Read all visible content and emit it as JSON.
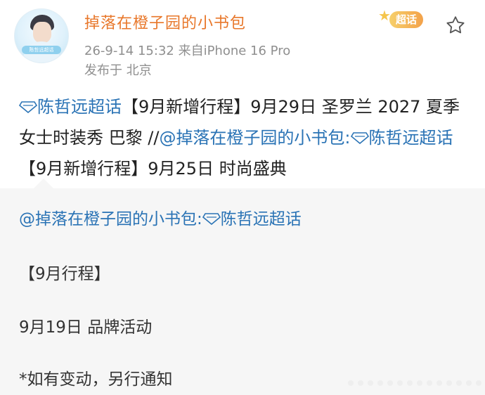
{
  "header": {
    "avatar_badge": "陈哲远超话",
    "username": "掉落在橙子园的小书包",
    "meta": "26-9-14 15:32  来自iPhone 16 Pro",
    "location": "发布于 北京",
    "supertopic_label": "超话"
  },
  "post": {
    "topic": "陈哲远超话",
    "text_part1": "【9月新增行程】9月29日 圣罗兰 2027 夏季女士时装秀 巴黎 //",
    "mention": "@掉落在橙子园的小书包:",
    "topic2": "陈哲远超话",
    "text_part2": "【9月新增行程】9月25日 时尚盛典"
  },
  "repost": {
    "author": "@掉落在橙子园的小书包:",
    "topic": "陈哲远超话",
    "line1": "【9月行程】",
    "line2": "9月19日 品牌活动",
    "line3": "*如有变动，另行通知"
  },
  "colors": {
    "username": "#e8772a",
    "link": "#2a73b5",
    "meta": "#8f8f8f",
    "repost_bg": "#f6f6f6"
  },
  "icons": [
    "diamond-icon",
    "star-icon",
    "supertopic-icon"
  ]
}
